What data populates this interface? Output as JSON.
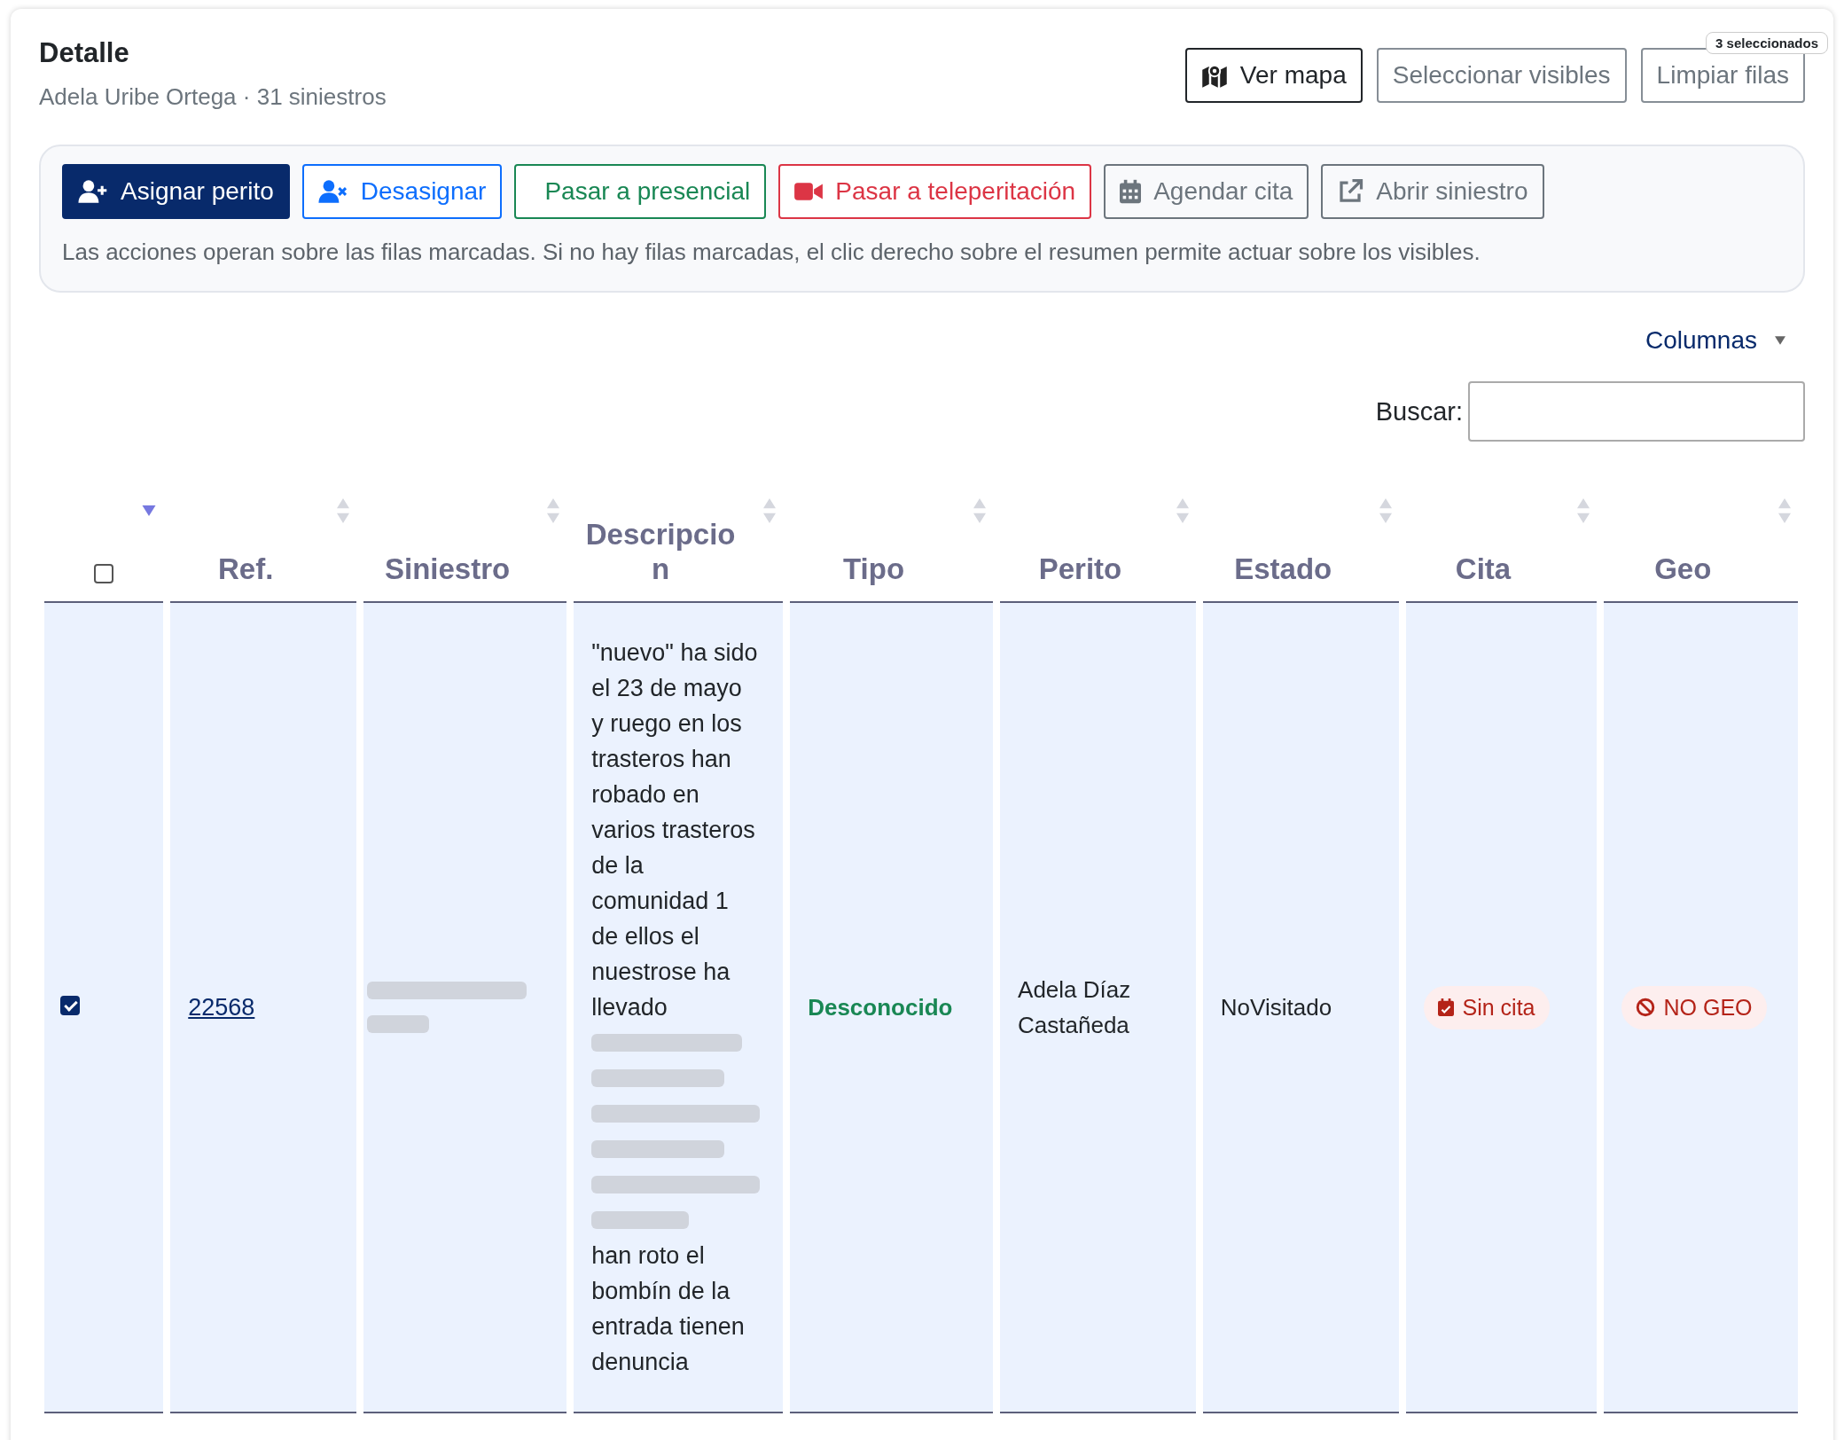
{
  "header": {
    "title": "Detalle",
    "subtitle": "Adela Uribe Ortega · 31 siniestros"
  },
  "top_buttons": [
    {
      "label": "Ver mapa",
      "kind": "map"
    },
    {
      "label": "Seleccionar visibles",
      "kind": "plain"
    },
    {
      "label": "Limpiar filas",
      "kind": "plain",
      "badge": "3 seleccionados"
    }
  ],
  "actions": {
    "buttons": [
      {
        "label": "Asignar perito",
        "kind": "assign"
      },
      {
        "label": "Desasignar",
        "kind": "unassign"
      },
      {
        "label": "Pasar a presencial",
        "kind": "onsite"
      },
      {
        "label": "Pasar a teleperitación",
        "kind": "remote"
      },
      {
        "label": "Agendar cita",
        "kind": "schedule"
      },
      {
        "label": "Abrir siniestro",
        "kind": "open"
      }
    ],
    "hint": "Las acciones operan sobre las filas marcadas. Si no hay filas marcadas, el clic derecho sobre el resumen permite actuar sobre los visibles."
  },
  "columns_toggle": "Columnas",
  "search": {
    "label": "Buscar:"
  },
  "table": {
    "select_column": {
      "checked": false,
      "sorted": true
    },
    "columns": [
      {
        "label": "Ref.",
        "sorted": false
      },
      {
        "label": "Siniestro",
        "sorted": false
      },
      {
        "label": "Descripcion",
        "sorted": false
      },
      {
        "label": "Tipo",
        "sorted": false
      },
      {
        "label": "Perito",
        "sorted": false
      },
      {
        "label": "Estado",
        "sorted": false
      },
      {
        "label": "Cita",
        "sorted": false
      },
      {
        "label": "Geo",
        "sorted": false
      }
    ],
    "rows": [
      {
        "selected": true,
        "ref": "22568",
        "description_start": "\"nuevo\" ha sido el 23 de mayo y ruego en los trasteros han robado en varios trasteros de la comunidad 1 de ellos el nuestrose ha llevado",
        "description_end": "han roto el bombín de la entrada tienen denuncia",
        "tipo": "Desconocido",
        "perito": "Adela Díaz Castañeda",
        "estado": "NoVisitado",
        "cita": "Sin cita",
        "geo": "NO GEO"
      }
    ]
  }
}
